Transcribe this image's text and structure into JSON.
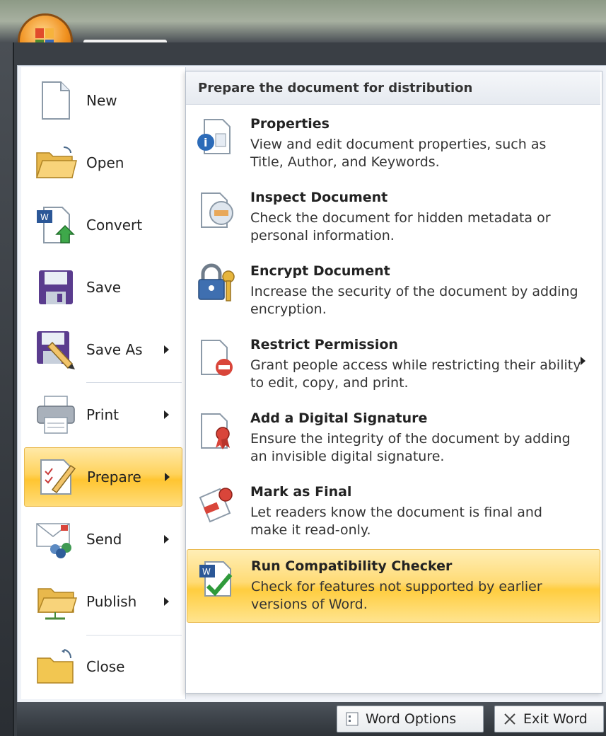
{
  "left_menu": {
    "items": [
      {
        "label": "New",
        "icon": "new-document-icon",
        "has_submenu": false
      },
      {
        "label": "Open",
        "icon": "open-folder-icon",
        "has_submenu": false
      },
      {
        "label": "Convert",
        "icon": "convert-icon",
        "has_submenu": false
      },
      {
        "label": "Save",
        "icon": "save-disk-icon",
        "has_submenu": false
      },
      {
        "label": "Save As",
        "icon": "save-as-icon",
        "has_submenu": true
      },
      {
        "label": "Print",
        "icon": "printer-icon",
        "has_submenu": true
      },
      {
        "label": "Prepare",
        "icon": "prepare-icon",
        "has_submenu": true,
        "active": true
      },
      {
        "label": "Send",
        "icon": "send-icon",
        "has_submenu": true
      },
      {
        "label": "Publish",
        "icon": "publish-icon",
        "has_submenu": true
      },
      {
        "label": "Close",
        "icon": "close-folder-icon",
        "has_submenu": false
      }
    ]
  },
  "submenu": {
    "header": "Prepare the document for distribution",
    "items": [
      {
        "title": "Properties",
        "description": "View and edit document properties, such as Title, Author, and Keywords.",
        "icon": "properties-icon"
      },
      {
        "title": "Inspect Document",
        "description": "Check the document for hidden metadata or personal information.",
        "icon": "inspect-document-icon"
      },
      {
        "title": "Encrypt Document",
        "description": "Increase the security of the document by adding encryption.",
        "icon": "encrypt-lock-icon"
      },
      {
        "title": "Restrict Permission",
        "description": "Grant people access while restricting their ability to edit, copy, and print.",
        "icon": "restrict-permission-icon",
        "has_submenu": true
      },
      {
        "title": "Add a Digital Signature",
        "description": "Ensure the integrity of the document by adding an invisible digital signature.",
        "icon": "digital-signature-icon"
      },
      {
        "title": "Mark as Final",
        "description": "Let readers know the document is final and make it read-only.",
        "icon": "mark-final-icon"
      },
      {
        "title": "Run Compatibility Checker",
        "description": "Check for features not supported by earlier versions of Word.",
        "icon": "compatibility-checker-icon",
        "active": true
      }
    ]
  },
  "footer": {
    "word_options_label": "Word Options",
    "exit_word_label": "Exit Word"
  },
  "colors": {
    "highlight": "#ffd35c",
    "office_orb": "#f0901e"
  }
}
